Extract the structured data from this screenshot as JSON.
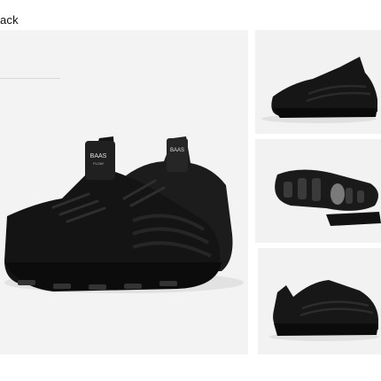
{
  "page": {
    "title_text": "ack"
  },
  "main_image": {
    "tongue_logo_text": "BAAS",
    "tongue_logo_sub": "FLOW",
    "tongue_logo_text_2": "BAAS"
  },
  "colors": {
    "background": "#ffffff",
    "panel": "#f3f3f3",
    "shoe": "#161616"
  },
  "icons": [
    "shoe-pair-image",
    "shoe-side-image",
    "shoe-sole-image",
    "shoe-angle-image"
  ]
}
